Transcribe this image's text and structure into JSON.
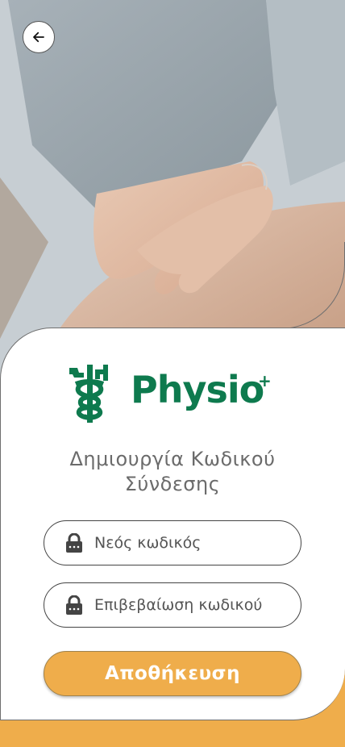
{
  "header": {
    "back_icon": "arrow-left-icon"
  },
  "brand": {
    "name": "Physio",
    "superscript": "+",
    "color": "#0e7a4e"
  },
  "form": {
    "title_line1": "Δημιουργία Κωδικού",
    "title_line2": "Σύνδεσης",
    "new_password": {
      "placeholder": "Νεός κωδικός",
      "value": "",
      "icon": "lock-icon"
    },
    "confirm_password": {
      "placeholder": "Επιβεβαίωση κωδικού",
      "value": "",
      "icon": "lock-icon"
    },
    "save_label": "Αποθήκευση"
  },
  "colors": {
    "accent": "#efad4b",
    "brand": "#0e7a4e",
    "text": "#6b6b6b"
  }
}
